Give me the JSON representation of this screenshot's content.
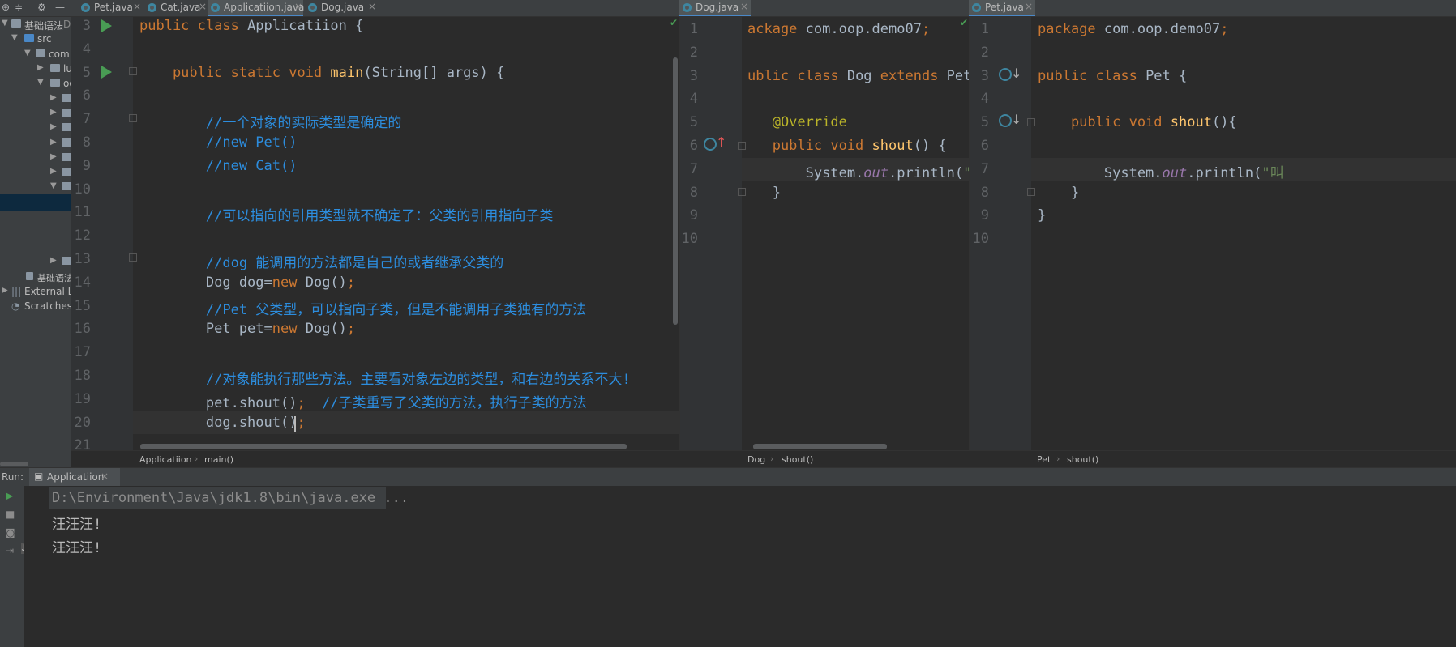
{
  "project": {
    "toolbar_icons": [
      "target-icon",
      "collapse-icon",
      "gear-icon",
      "minimize-icon"
    ],
    "items": [
      {
        "label": "基础语法",
        "suffix": "D:",
        "depth": 0
      },
      {
        "label": "src",
        "depth": 1
      },
      {
        "label": "com",
        "depth": 2
      },
      {
        "label": "lu",
        "depth": 3
      },
      {
        "label": "oo",
        "depth": 3
      },
      {
        "label": "基础语法",
        "depth": 1
      },
      {
        "label": "External Lib",
        "depth": 0
      },
      {
        "label": "Scratches a",
        "depth": 0
      }
    ]
  },
  "main_tabs": [
    {
      "label": "Pet.java"
    },
    {
      "label": "Cat.java"
    },
    {
      "label": "Applicatiion.java"
    },
    {
      "label": "Dog.java"
    }
  ],
  "dog_tab": {
    "label": "Dog.java"
  },
  "pet_tab": {
    "label": "Pet.java"
  },
  "editor_main": {
    "lines": [
      {
        "n": "3",
        "parts": [
          [
            "kw",
            "public class "
          ],
          [
            "cls",
            "Applicatiion"
          ],
          [
            "cls",
            " {"
          ]
        ]
      },
      {
        "n": "4",
        "parts": []
      },
      {
        "n": "5",
        "parts": [
          [
            "kw",
            "    public static void "
          ],
          [
            "fn",
            "main"
          ],
          [
            "cls",
            "(String[] args) {"
          ]
        ]
      },
      {
        "n": "6",
        "parts": []
      },
      {
        "n": "7",
        "parts": [
          [
            "cm",
            "        //一个对象的实际类型是确定的"
          ]
        ]
      },
      {
        "n": "8",
        "parts": [
          [
            "cm",
            "        //new Pet()"
          ]
        ]
      },
      {
        "n": "9",
        "parts": [
          [
            "cm",
            "        //new Cat()"
          ]
        ]
      },
      {
        "n": "10",
        "parts": []
      },
      {
        "n": "11",
        "parts": [
          [
            "cm",
            "        //可以指向的引用类型就不确定了：父类的引用指向子类"
          ]
        ]
      },
      {
        "n": "12",
        "parts": []
      },
      {
        "n": "13",
        "parts": [
          [
            "cm",
            "        //dog 能调用的方法都是自己的或者继承父类的"
          ]
        ]
      },
      {
        "n": "14",
        "parts": [
          [
            "cls",
            "        Dog dog="
          ],
          [
            "kw",
            "new "
          ],
          [
            "cls",
            "Dog()"
          ],
          [
            "kw",
            ";"
          ]
        ]
      },
      {
        "n": "15",
        "parts": [
          [
            "cm",
            "        //Pet 父类型，可以指向子类，但是不能调用子类独有的方法"
          ]
        ]
      },
      {
        "n": "16",
        "parts": [
          [
            "cls",
            "        Pet pet="
          ],
          [
            "kw",
            "new "
          ],
          [
            "cls",
            "Dog()"
          ],
          [
            "kw",
            ";"
          ]
        ]
      },
      {
        "n": "17",
        "parts": []
      },
      {
        "n": "18",
        "parts": [
          [
            "cm",
            "        //对象能执行那些方法。主要看对象左边的类型，和右边的关系不大!"
          ]
        ]
      },
      {
        "n": "19",
        "parts": [
          [
            "cls",
            "        pet.shout()"
          ],
          [
            "kw",
            ";  "
          ],
          [
            "cm",
            "//子类重写了父类的方法，执行子类的方法"
          ]
        ]
      },
      {
        "n": "20",
        "parts": [
          [
            "cls",
            "        dog.shout()"
          ],
          [
            "kw",
            ";"
          ]
        ]
      },
      {
        "n": "21",
        "parts": []
      }
    ],
    "breadcrumb": [
      "Applicatiion",
      "main()"
    ]
  },
  "editor_dog": {
    "lines": [
      {
        "n": "1",
        "parts": [
          [
            "kw",
            "ackage "
          ],
          [
            "cls",
            "com.oop.demo07"
          ],
          [
            "kw",
            ";"
          ]
        ]
      },
      {
        "n": "2",
        "parts": []
      },
      {
        "n": "3",
        "parts": [
          [
            "kw",
            "ublic class "
          ],
          [
            "cls",
            "Dog "
          ],
          [
            "kw",
            "extends "
          ],
          [
            "cls",
            "Pet{"
          ]
        ]
      },
      {
        "n": "4",
        "parts": []
      },
      {
        "n": "5",
        "parts": [
          [
            "an",
            "   @Override"
          ]
        ]
      },
      {
        "n": "6",
        "parts": [
          [
            "kw",
            "   public void "
          ],
          [
            "fn",
            "shout"
          ],
          [
            "cls",
            "() {"
          ]
        ]
      },
      {
        "n": "7",
        "parts": [
          [
            "cls",
            "       System."
          ],
          [
            "it",
            "out"
          ],
          [
            "cls",
            ".println("
          ],
          [
            "str",
            "\"汪"
          ]
        ]
      },
      {
        "n": "8",
        "parts": [
          [
            "cls",
            "   }"
          ]
        ]
      },
      {
        "n": "9",
        "parts": []
      },
      {
        "n": "10",
        "parts": []
      }
    ],
    "breadcrumb": [
      "Dog",
      "shout()"
    ]
  },
  "editor_pet": {
    "lines": [
      {
        "n": "1",
        "parts": [
          [
            "kw",
            "package "
          ],
          [
            "cls",
            "com.oop.demo07"
          ],
          [
            "kw",
            ";"
          ]
        ]
      },
      {
        "n": "2",
        "parts": []
      },
      {
        "n": "3",
        "parts": [
          [
            "kw",
            "public class "
          ],
          [
            "cls",
            "Pet {"
          ]
        ]
      },
      {
        "n": "4",
        "parts": []
      },
      {
        "n": "5",
        "parts": [
          [
            "kw",
            "    public void "
          ],
          [
            "fn",
            "shout"
          ],
          [
            "cls",
            "(){"
          ]
        ]
      },
      {
        "n": "6",
        "parts": []
      },
      {
        "n": "7",
        "parts": [
          [
            "cls",
            "        System."
          ],
          [
            "it",
            "out"
          ],
          [
            "cls",
            ".println("
          ],
          [
            "str",
            "\"叫"
          ]
        ]
      },
      {
        "n": "8",
        "parts": [
          [
            "cls",
            "    }"
          ]
        ]
      },
      {
        "n": "9",
        "parts": [
          [
            "cls",
            "}"
          ]
        ]
      },
      {
        "n": "10",
        "parts": []
      }
    ],
    "breadcrumb": [
      "Pet",
      "shout()"
    ]
  },
  "run": {
    "label": "Run:",
    "tab": "Applicatiion",
    "command": "D:\\Environment\\Java\\jdk1.8\\bin\\java.exe ...",
    "output": [
      "汪汪汪!",
      "汪汪汪!"
    ]
  },
  "colors": {
    "keyword": "#cc7832",
    "comment": "#2c8dde",
    "method": "#ffc66d",
    "annotation": "#bbb529",
    "field": "#9876aa",
    "run_green": "#499c54"
  }
}
